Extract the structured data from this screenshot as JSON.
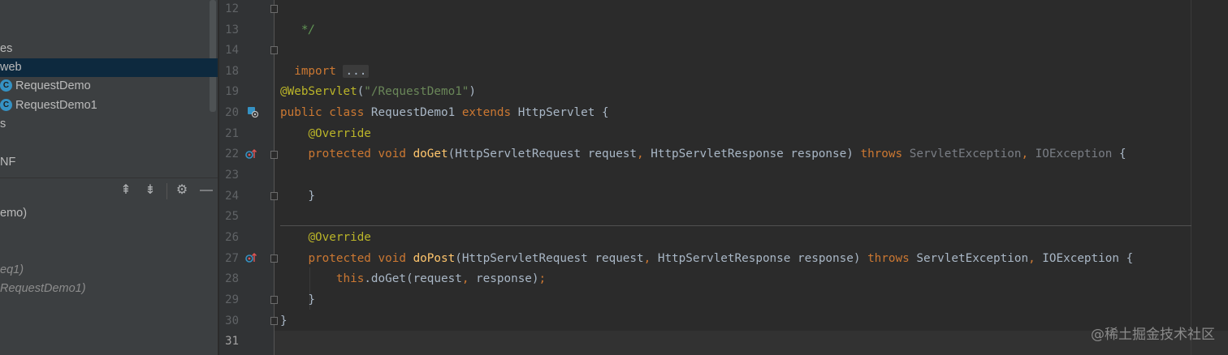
{
  "project_tree": [
    {
      "label": "es",
      "selected": false
    },
    {
      "label": "web",
      "selected": true
    },
    {
      "label": "RequestDemo",
      "icon": "class-icon",
      "icon_letter": "C"
    },
    {
      "label": "RequestDemo1",
      "icon": "class-icon",
      "icon_letter": "C"
    },
    {
      "label": "s"
    },
    {
      "label": "NF"
    }
  ],
  "structure_toolbar": {
    "expand_all_glyph": "⇞",
    "collapse_all_glyph": "⇟",
    "settings_glyph": "⚙",
    "hide_glyph": "—"
  },
  "structure_items": [
    {
      "label": "emo)",
      "italic": false
    },
    {
      "label": "eq1)",
      "italic": true
    },
    {
      "label": "RequestDemo1)",
      "italic": true
    }
  ],
  "line_numbers": [
    "12",
    "13",
    "14",
    "18",
    "19",
    "20",
    "21",
    "22",
    "23",
    "24",
    "25",
    "26",
    "27",
    "28",
    "29",
    "30",
    "31"
  ],
  "code": {
    "l12": {
      "comment": " */"
    },
    "l14": {
      "kw_import": "import",
      "folded": "..."
    },
    "l19": {
      "annotation": "@WebServlet",
      "open": "(",
      "string": "\"/RequestDemo1\"",
      "close": ")"
    },
    "l20": {
      "kw1": "public",
      "kw2": "class",
      "name": " RequestDemo1 ",
      "kw3": "extends",
      "rest": " HttpServlet {"
    },
    "l21": {
      "annotation": "@Override"
    },
    "l22": {
      "kw1": "protected",
      "kw2": "void",
      "method": "doGet",
      "params": "(HttpServletRequest request",
      "comma": ",",
      "params2": " HttpServletResponse response) ",
      "throws": "throws",
      "exc1": " ServletException",
      "comma2": ",",
      "exc2": " IOException",
      "brace": " {"
    },
    "l24": {
      "text": "    }"
    },
    "l26": {
      "annotation": "@Override"
    },
    "l27": {
      "kw1": "protected",
      "kw2": "void",
      "method": "doPost",
      "params": "(HttpServletRequest request",
      "comma": ",",
      "params2": " HttpServletResponse response) ",
      "throws": "throws",
      "exc1": " ServletException",
      "comma2": ",",
      "exc2": " IOException",
      "brace": " {"
    },
    "l28": {
      "kw_this": "this",
      "call": ".doGet(request",
      "comma": ",",
      "args": " response)",
      "semi": ";"
    },
    "l29": {
      "text": "    }"
    },
    "l30": {
      "text": "}"
    }
  },
  "watermark": "@稀土掘金技术社区",
  "colors": {
    "keyword": "#cc7832",
    "annotation": "#bbb529",
    "string": "#6a8759",
    "method": "#ffc66d",
    "text": "#a9b7c6",
    "background": "#2b2b2b"
  }
}
